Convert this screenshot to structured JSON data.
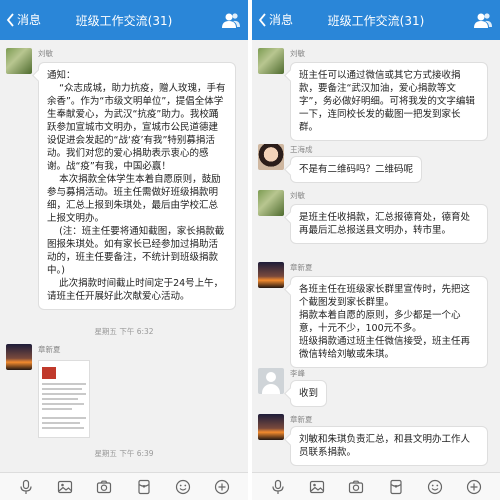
{
  "header": {
    "back_label": "消息",
    "title": "班级工作交流(31)"
  },
  "left": {
    "msg1": {
      "sender": "刘敏",
      "text": "通知：\n    “众志成城，助力抗疫，赠人玫瑰，手有余香”。作为“市级文明单位”，提倡全体学生奉献爱心，为武汉“抗疫”助力。我校踊跃参加宣城市文明办，宣城市公民道德建设促进会发起的“战‘疫’有我”特别募捐活动。我们对您的爱心捐助表示衷心的感谢。战“疫”有我，中国必赢！\n    本次捐款全体学生本着自愿原则，鼓励参与募捐活动。班主任需做好班级捐款明细，汇总上报到朱琪处，最后由学校汇总上报文明办。\n    (注：班主任要将通知截图，家长捐款截图报朱琪处。如有家长已经参加过捐助活动的，班主任要备注，不统计到班级捐款中。)\n    此次捐款时间截止时间定于24号上午，请班主任开展好此次献爱心活动。"
    },
    "time1": "星期五 下午 6:32",
    "msg2": {
      "sender": "章新夏"
    },
    "time2": "星期五 下午 6:39"
  },
  "right": {
    "msg1": {
      "sender": "刘敏",
      "text": "班主任可以通过微信或其它方式接收捐款，要备注“武汉加油，爱心捐款等文字”，务必做好明细。可将我发的文字编辑一下，连同校长发的截图一把发到家长群。"
    },
    "msg2": {
      "sender": "王海成",
      "text": "不是有二维码吗？二维码呢"
    },
    "msg3": {
      "sender": "刘敏",
      "text": "是班主任收捐款，汇总报德育处，德育处再最后汇总报送县文明办，转市里。"
    },
    "msg4": {
      "sender": "章新夏",
      "text": "各班主任在班级家长群里宣传时，先把这个截图发到家长群里。\n捐款本着自愿的原则，多少都是一个心意，十元不少，100元不多。\n班级捐款通过班主任微信接受，班主任再微信转给刘敏或朱琪。"
    },
    "msg5": {
      "sender": "李峰",
      "text": "收到"
    },
    "msg6": {
      "sender": "章新夏",
      "text": "刘敏和朱琪负责汇总，和县文明办工作人员联系捐款。"
    }
  },
  "icons": {
    "back": "chevron-left-icon",
    "group": "group-members-icon",
    "voice": "microphone-icon",
    "image": "image-icon",
    "camera": "camera-icon",
    "red_packet": "red-packet-icon",
    "emoji": "emoji-icon",
    "more": "plus-icon"
  },
  "colors": {
    "header": "#2a86d8",
    "background": "#f1f1f1",
    "bubble": "#ffffff"
  }
}
